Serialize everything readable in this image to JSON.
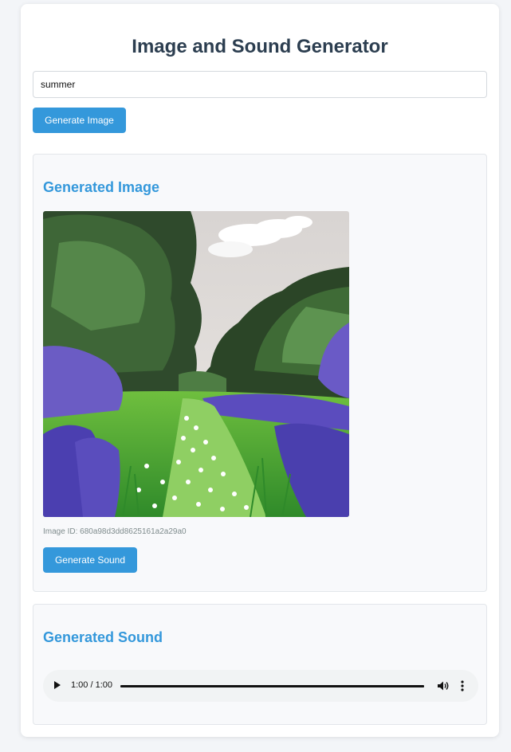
{
  "page": {
    "title": "Image and Sound Generator"
  },
  "prompt": {
    "value": "summer"
  },
  "buttons": {
    "generate_image": "Generate Image",
    "generate_sound": "Generate Sound"
  },
  "image_section": {
    "heading": "Generated Image",
    "image_id_text": "Image ID: 680a98d3dd8625161a2a29a0"
  },
  "sound_section": {
    "heading": "Generated Sound",
    "player": {
      "time_readout": "1:00 / 1:00",
      "progress": 1.0
    }
  },
  "colors": {
    "accent": "#3498db",
    "title": "#2c3e50",
    "muted": "#7f8c8d"
  },
  "icons": [
    "play-icon",
    "volume-icon",
    "more-vertical-icon"
  ]
}
